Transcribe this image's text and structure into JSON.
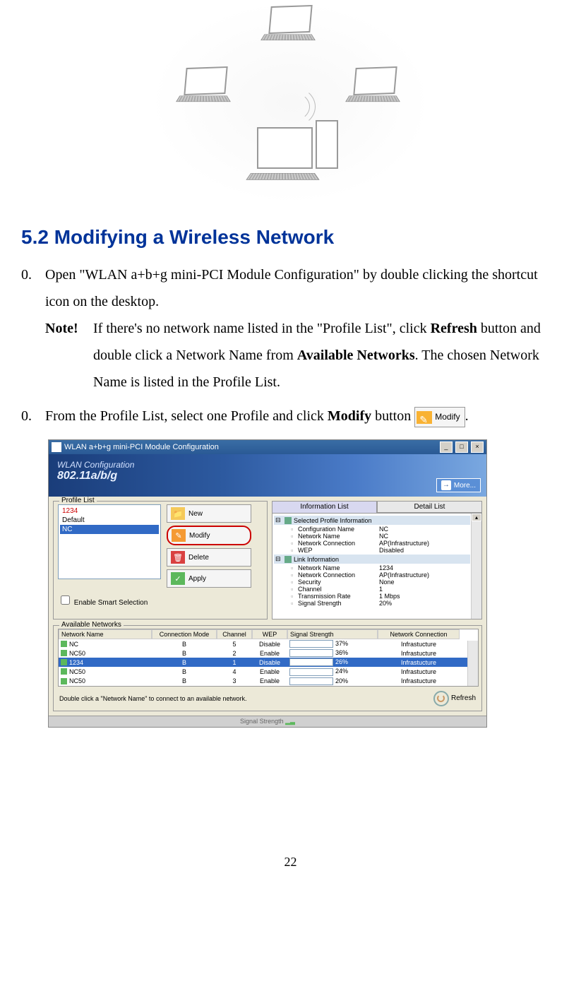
{
  "section": {
    "heading": "5.2 Modifying a Wireless Network"
  },
  "steps": [
    {
      "num": "0.",
      "text_a": "Open \"WLAN a+b+g mini-PCI Module Configuration\" by double clicking the shortcut icon on the desktop.",
      "note_label": "Note!",
      "note_a": "If there's no network name listed in the \"Profile List\", click ",
      "note_b": " button and double click a Network Name from ",
      "note_c": ". The chosen Network Name is listed in the Profile List.",
      "refresh_word": "Refresh",
      "avail_word": "Available Networks"
    },
    {
      "num": "0.",
      "text_a": "From the Profile List, select one Profile and click ",
      "modify_word": "Modify",
      "text_b": " button  ",
      "btn_label": "Modify",
      "text_c": "."
    }
  ],
  "app": {
    "title": "WLAN a+b+g mini-PCI Module Configuration",
    "banner_line1": "WLAN Configuration",
    "banner_line2": "802.11a/b/g",
    "more": "More...",
    "profile_group": "Profile List",
    "profiles": [
      "1234",
      "Default",
      "NC"
    ],
    "selected_profile_index": 2,
    "buttons": {
      "new": "New",
      "modify": "Modify",
      "delete": "Delete",
      "apply": "Apply"
    },
    "smart_selection": "Enable Smart Selection",
    "tabs": {
      "info": "Information List",
      "detail": "Detail List"
    },
    "tree": {
      "group1": "Selected Profile Information",
      "rows1": [
        {
          "k": "Configuration Name",
          "v": "NC"
        },
        {
          "k": "Network Name",
          "v": "NC"
        },
        {
          "k": "Network Connection",
          "v": "AP(Infrastructure)"
        },
        {
          "k": "WEP",
          "v": "Disabled"
        }
      ],
      "group2": "Link Information",
      "rows2": [
        {
          "k": "Network Name",
          "v": "1234"
        },
        {
          "k": "Network Connection",
          "v": "AP(Infrastructure)"
        },
        {
          "k": "Security",
          "v": "None"
        },
        {
          "k": "Channel",
          "v": "1"
        },
        {
          "k": "Transmission Rate",
          "v": "1 Mbps"
        },
        {
          "k": "Signal Strength",
          "v": "20%"
        }
      ]
    },
    "avail_group": "Available Networks",
    "columns": {
      "name": "Network Name",
      "mode": "Connection Mode",
      "chan": "Channel",
      "wep": "WEP",
      "sig": "Signal Strength",
      "conn": "Network Connection"
    },
    "networks": [
      {
        "name": "NC",
        "mode": "B",
        "chan": "5",
        "wep": "Disable",
        "sig_pct": 37,
        "sig_txt": "37%",
        "conn": "Infrastucture",
        "sel": false
      },
      {
        "name": "NC50",
        "mode": "B",
        "chan": "2",
        "wep": "Enable",
        "sig_pct": 36,
        "sig_txt": "36%",
        "conn": "Infrastucture",
        "sel": false
      },
      {
        "name": "1234",
        "mode": "B",
        "chan": "1",
        "wep": "Disable",
        "sig_pct": 26,
        "sig_txt": "26%",
        "conn": "Infrastucture",
        "sel": true
      },
      {
        "name": "NC50",
        "mode": "B",
        "chan": "4",
        "wep": "Enable",
        "sig_pct": 24,
        "sig_txt": "24%",
        "conn": "Infrastucture",
        "sel": false
      },
      {
        "name": "NC50",
        "mode": "B",
        "chan": "3",
        "wep": "Enable",
        "sig_pct": 20,
        "sig_txt": "20%",
        "conn": "Infrastucture",
        "sel": false
      }
    ],
    "footer_hint": "Double click a \"Network Name\" to connect to an available network.",
    "refresh": "Refresh",
    "status": "Signal Strength"
  },
  "page_number": "22"
}
